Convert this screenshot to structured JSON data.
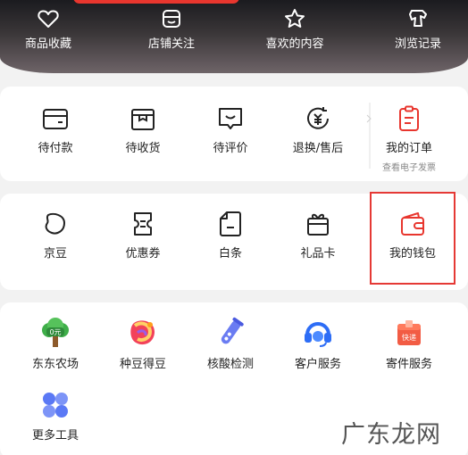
{
  "header": {
    "items": [
      {
        "label": "商品收藏",
        "icon": "heart-icon"
      },
      {
        "label": "店铺关注",
        "icon": "shop-icon"
      },
      {
        "label": "喜欢的内容",
        "icon": "star-icon"
      },
      {
        "label": "浏览记录",
        "icon": "footprint-icon"
      }
    ]
  },
  "orders": {
    "items": [
      {
        "label": "待付款",
        "icon": "wallet-icon"
      },
      {
        "label": "待收货",
        "icon": "package-icon"
      },
      {
        "label": "待评价",
        "icon": "comment-icon"
      },
      {
        "label": "退换/售后",
        "icon": "refund-icon"
      }
    ],
    "my_orders": {
      "label": "我的订单",
      "sub": "查看电子发票",
      "icon": "order-list-icon"
    }
  },
  "assets": {
    "items": [
      {
        "label": "京豆",
        "icon": "bean-icon"
      },
      {
        "label": "优惠券",
        "icon": "coupon-icon"
      },
      {
        "label": "白条",
        "icon": "iou-icon"
      },
      {
        "label": "礼品卡",
        "icon": "gift-card-icon"
      },
      {
        "label": "我的钱包",
        "icon": "red-wallet-icon"
      }
    ]
  },
  "tools": {
    "items": [
      {
        "label": "东东农场",
        "icon": "farm-tree-icon",
        "badge": "0元"
      },
      {
        "label": "种豆得豆",
        "icon": "bean-sprout-icon"
      },
      {
        "label": "核酸检测",
        "icon": "test-tube-icon"
      },
      {
        "label": "客户服务",
        "icon": "headset-icon"
      },
      {
        "label": "寄件服务",
        "icon": "express-box-icon",
        "badge": "快递"
      },
      {
        "label": "更多工具",
        "icon": "more-tools-icon"
      }
    ]
  },
  "watermark": {
    "text": "广东龙网"
  },
  "colors": {
    "accent": "#e8362e",
    "text": "#222222",
    "subtext": "#888888"
  }
}
